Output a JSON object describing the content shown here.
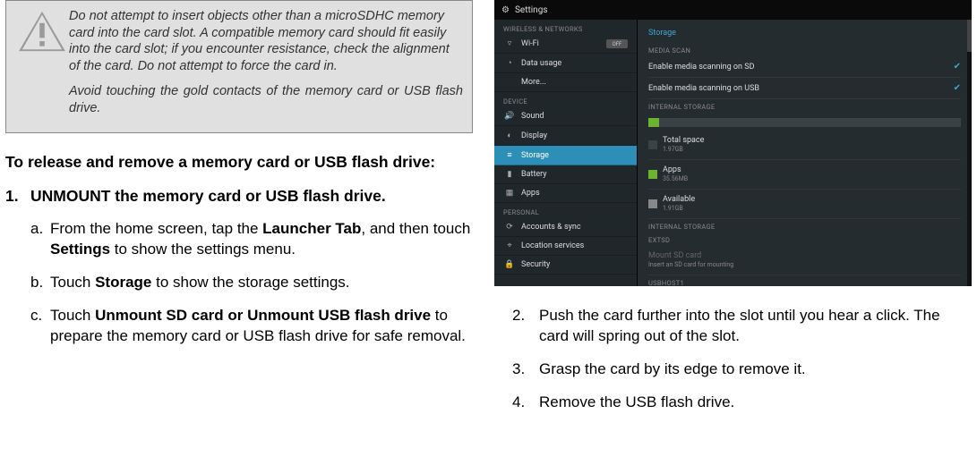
{
  "warning": {
    "p1": "Do not attempt to insert objects other than a microSDHC memory card into the card slot. A compatible memory card should fit easily into the card slot; if you encounter resistance, check the alignment of the card. Do not attempt to force the card in.",
    "p2": "Avoid touching the gold contacts of the memory card or USB flash drive."
  },
  "left": {
    "lead": "To release and remove a memory card or USB flash drive:",
    "step1_num": "1.",
    "step1": "UNMOUNT the memory card or USB flash drive.",
    "a_let": "a.",
    "a_1": "From the home screen, tap the ",
    "a_b1": "Launcher Tab",
    "a_2": ", and then touch ",
    "a_b2": "Settings",
    "a_3": " to show the settings menu.",
    "b_let": "b.",
    "b_1": "Touch ",
    "b_b1": "Storage",
    "b_2": " to show the storage settings.",
    "c_let": "c.",
    "c_1": "Touch ",
    "c_b1": "Unmount SD card or Unmount USB flash drive",
    "c_2": " to prepare the memory card or USB flash drive for safe removal."
  },
  "shot": {
    "title": "Settings",
    "cat_wireless": "WIRELESS & NETWORKS",
    "wifi": "Wi-Fi",
    "wifi_state": "OFF",
    "data": "Data usage",
    "more": "More...",
    "cat_device": "DEVICE",
    "sound": "Sound",
    "display": "Display",
    "storage": "Storage",
    "battery": "Battery",
    "apps": "Apps",
    "cat_personal": "PERSONAL",
    "accounts": "Accounts & sync",
    "location": "Location services",
    "security": "Security",
    "r_storage": "Storage",
    "r_mediascan": "MEDIA SCAN",
    "scan_sd": "Enable media scanning on SD",
    "scan_usb": "Enable media scanning on USB",
    "r_internal": "INTERNAL STORAGE",
    "total": "Total space",
    "total_v": "1.97GB",
    "apps_l": "Apps",
    "apps_v": "35.56MB",
    "avail": "Available",
    "avail_v": "1.91GB",
    "r_internal2": "INTERNAL STORAGE",
    "r_extsd": "EXTSD",
    "mount": "Mount SD card",
    "mount_sub": "Insert an SD card for mounting",
    "r_usbhost": "USBHOST1"
  },
  "right": {
    "s2n": "2.",
    "s2": "Push the card further into the slot until you hear a click. The card will spring out of the slot.",
    "s3n": "3.",
    "s3": "Grasp the card by its edge to remove it.",
    "s4n": "4.",
    "s4": "Remove the USB flash drive."
  }
}
